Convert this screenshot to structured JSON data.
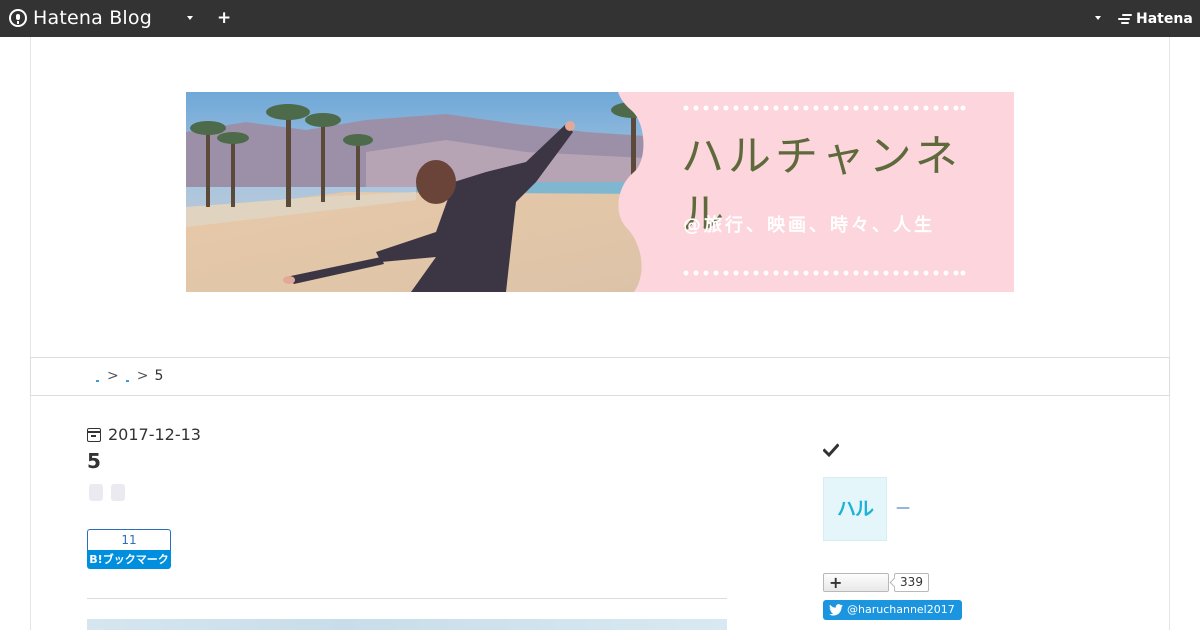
{
  "topbar": {
    "brand_label": "Hatena Blog",
    "brand_icon": "hatena-blog-logo-icon",
    "menu_caret_icon": "chevron-down-icon",
    "add_icon": "plus-icon",
    "right_caret_icon": "chevron-down-icon",
    "hatena_label": "Hatena",
    "hatena_icon": "hatena-logo-icon"
  },
  "header": {
    "title": "ハルチャンネル",
    "subtitle": "@旅行、映画、時々、人生"
  },
  "breadcrumb": {
    "separator": ">",
    "current": "5"
  },
  "entry": {
    "date": "2017-12-13",
    "title": "5",
    "bookmark_count": "11",
    "bookmark_label": "B!ブックマーク"
  },
  "sidebar": {
    "profile_icon_text": "ハル",
    "profile_name": "—",
    "follow_count": "339",
    "twitter_handle": "@haruchannel2017"
  },
  "colors": {
    "topbar_bg": "#333333",
    "banner_pink": "#fdd5dc",
    "banner_title": "#5e6a3c",
    "link_blue": "#2c6ebd",
    "bookmark_blue": "#008fde",
    "twitter_blue": "#1b95e0"
  }
}
